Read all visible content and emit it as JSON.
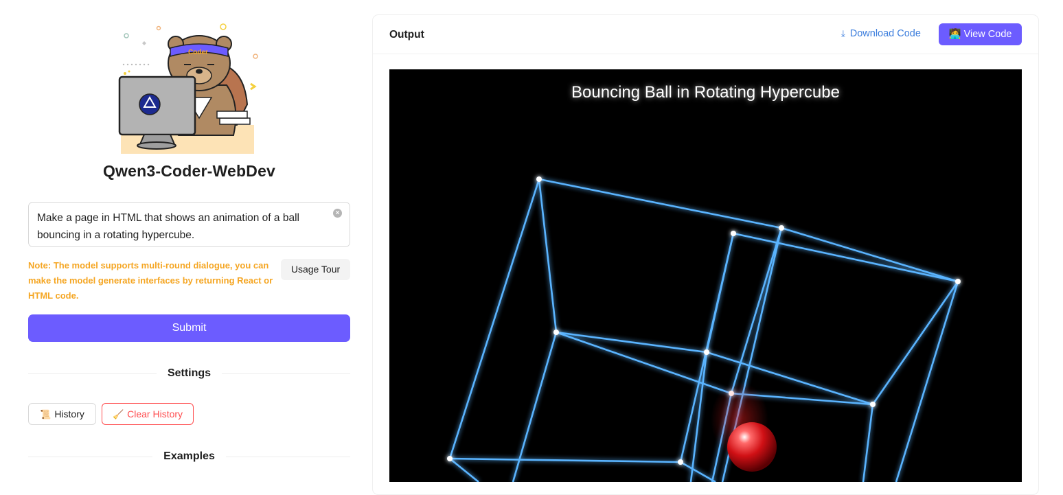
{
  "app": {
    "title": "Qwen3-Coder-WebDev",
    "logo_badge": "Coder"
  },
  "prompt": {
    "value": "Make a page in HTML that shows an animation of a ball bouncing in a rotating hypercube."
  },
  "note": "Note: The model supports multi-round dialogue, you can make the model generate interfaces by returning React or HTML code.",
  "buttons": {
    "usage_tour": "Usage Tour",
    "submit": "Submit",
    "history": "History",
    "clear_history": "Clear History"
  },
  "sections": {
    "settings": "Settings",
    "examples": "Examples"
  },
  "output": {
    "title": "Output",
    "download_label": "Download Code",
    "view_label": "View Code",
    "canvas_title": "Bouncing Ball in Rotating Hypercube"
  },
  "colors": {
    "accent": "#6c5cff",
    "note": "#f5a623",
    "danger": "#ff4d4f",
    "link": "#3b7ddd",
    "edge": "#5ab4ff",
    "ball": "#e0181c"
  },
  "icons": {
    "clear": "close-circle-icon",
    "download": "download-icon",
    "view": "user-code-icon",
    "history": "scroll-icon",
    "clear_history": "broom-icon"
  }
}
